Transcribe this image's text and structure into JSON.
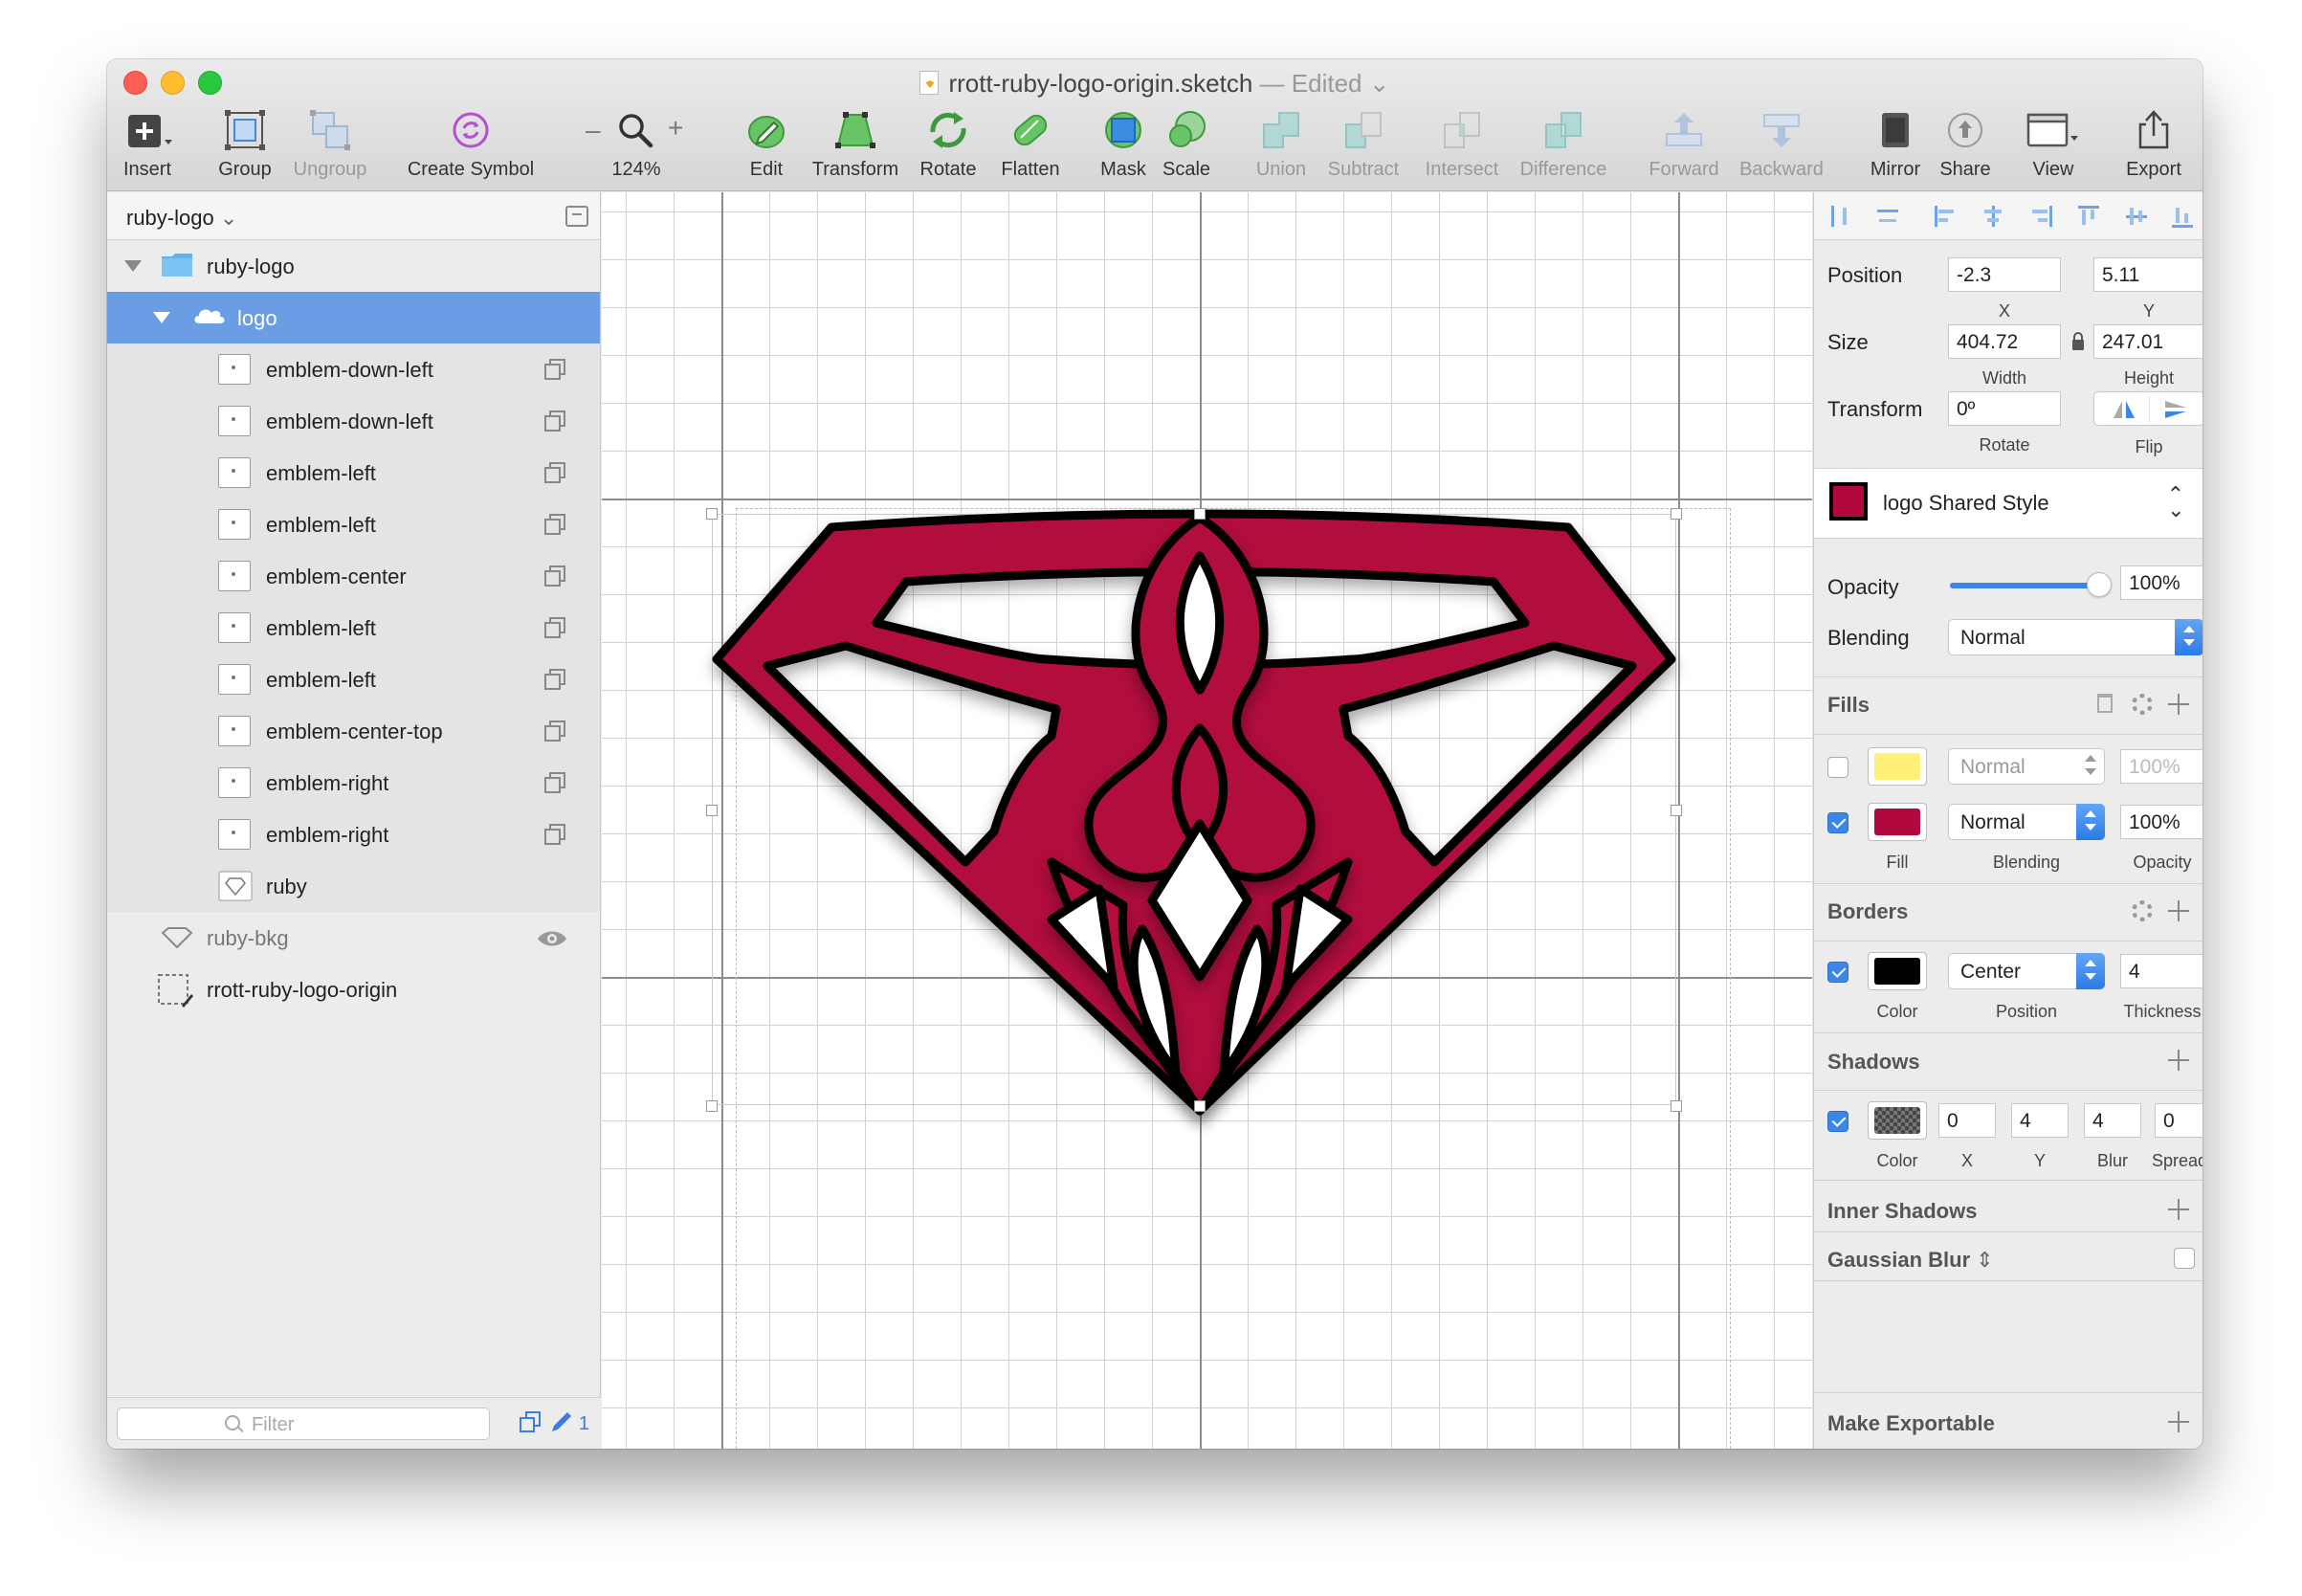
{
  "window": {
    "doc_title": "rrott-ruby-logo-origin.sketch",
    "title_separator": "—",
    "edited_label": "Edited"
  },
  "toolbar": {
    "insert": "Insert",
    "group": "Group",
    "ungroup": "Ungroup",
    "create_symbol": "Create Symbol",
    "zoom_minus": "–",
    "zoom_plus": "+",
    "zoom_level": "124%",
    "edit": "Edit",
    "transform": "Transform",
    "rotate": "Rotate",
    "flatten": "Flatten",
    "mask": "Mask",
    "scale": "Scale",
    "union": "Union",
    "subtract": "Subtract",
    "intersect": "Intersect",
    "difference": "Difference",
    "forward": "Forward",
    "backward": "Backward",
    "mirror": "Mirror",
    "share": "Share",
    "view": "View",
    "export": "Export"
  },
  "sidebar": {
    "page_name": "ruby-logo",
    "filter_placeholder": "Filter",
    "footer_count": "1",
    "layers": [
      {
        "label": "ruby-logo"
      },
      {
        "label": "logo"
      },
      {
        "label": "emblem-down-left"
      },
      {
        "label": "emblem-down-left"
      },
      {
        "label": "emblem-left"
      },
      {
        "label": "emblem-left"
      },
      {
        "label": "emblem-center"
      },
      {
        "label": "emblem-left"
      },
      {
        "label": "emblem-left"
      },
      {
        "label": "emblem-center-top"
      },
      {
        "label": "emblem-right"
      },
      {
        "label": "emblem-right"
      },
      {
        "label": "ruby"
      },
      {
        "label": "ruby-bkg"
      },
      {
        "label": "rrott-ruby-logo-origin"
      }
    ]
  },
  "inspector": {
    "position_label": "Position",
    "x_value": "-2.3",
    "y_value": "5.11",
    "x_label": "X",
    "y_label": "Y",
    "size_label": "Size",
    "width_value": "404.72",
    "height_value": "247.01",
    "width_label": "Width",
    "height_label": "Height",
    "transform_label": "Transform",
    "rotate_value": "0º",
    "rotate_label": "Rotate",
    "flip_label": "Flip",
    "shared_style": "logo Shared Style",
    "opacity_label": "Opacity",
    "opacity_value": "100%",
    "opacity_fraction": 1.0,
    "blending_label": "Blending",
    "blending_value": "Normal",
    "fills": {
      "title": "Fills",
      "rows": [
        {
          "enabled": false,
          "color": "#fff07a",
          "blending": "Normal",
          "opacity": "100%"
        },
        {
          "enabled": true,
          "color": "#b1083e",
          "blending": "Normal",
          "opacity": "100%"
        }
      ],
      "fill_label": "Fill",
      "blending_label": "Blending",
      "opacity_label": "Opacity"
    },
    "borders": {
      "title": "Borders",
      "enabled": true,
      "color": "#000000",
      "position": "Center",
      "thickness": "4",
      "color_label": "Color",
      "position_label": "Position",
      "thickness_label": "Thickness"
    },
    "shadows": {
      "title": "Shadows",
      "enabled": true,
      "x": "0",
      "y": "4",
      "blur": "4",
      "spread": "0",
      "color_label": "Color",
      "x_label": "X",
      "y_label": "Y",
      "blur_label": "Blur",
      "spread_label": "Spread"
    },
    "inner_shadows_title": "Inner Shadows",
    "gaussian_blur_title": "Gaussian Blur",
    "make_exportable": "Make Exportable"
  },
  "colors": {
    "accent": "#3c86ea",
    "selection": "#6a9de4",
    "ruby": "#b1083e",
    "folder": "#5ab4f0"
  }
}
